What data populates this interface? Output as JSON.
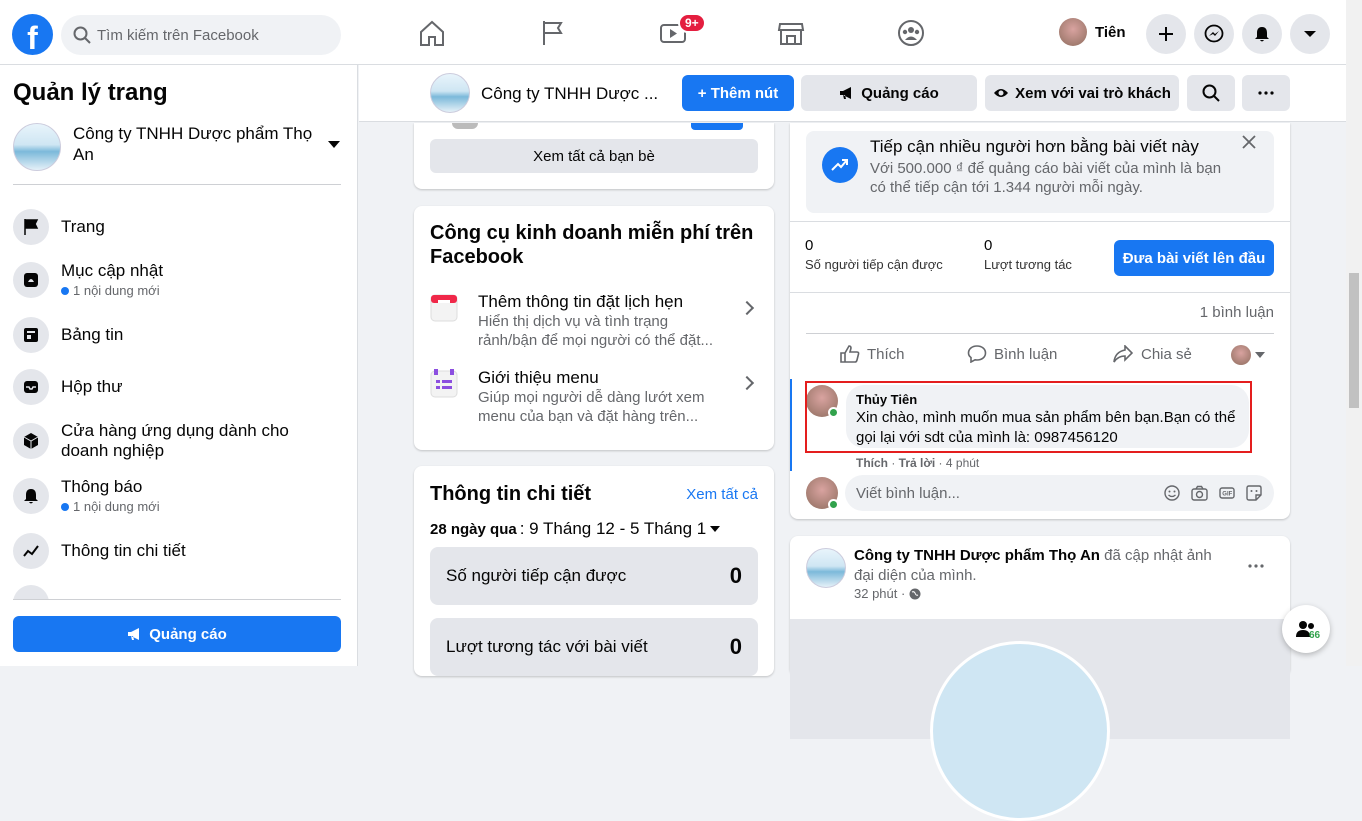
{
  "topbar": {
    "search_placeholder": "Tìm kiếm trên Facebook",
    "badge": "9+",
    "profile_name": "Tiên"
  },
  "sidebar": {
    "title": "Quản lý trang",
    "page_name": "Công ty TNHH Dược phẩm Thọ An",
    "items": [
      {
        "label": "Trang",
        "sub": ""
      },
      {
        "label": "Mục cập nhật",
        "sub": "1 nội dung mới"
      },
      {
        "label": "Bảng tin",
        "sub": ""
      },
      {
        "label": "Hộp thư",
        "sub": ""
      },
      {
        "label": "Cửa hàng ứng dụng dành cho doanh nghiệp",
        "sub": ""
      },
      {
        "label": "Thông báo",
        "sub": "1 nội dung mới"
      },
      {
        "label": "Thông tin chi tiết",
        "sub": ""
      }
    ],
    "ad_button": "Quảng cáo"
  },
  "page_header": {
    "page_name": "Công ty TNHH Dược ...",
    "add_button": "+ Thêm nút",
    "ads_button": "Quảng cáo",
    "view_as_button": "Xem với vai trò khách"
  },
  "friends": {
    "see_all": "Xem tất cả bạn bè"
  },
  "tools": {
    "title": "Công cụ kinh doanh miễn phí trên Facebook",
    "items": [
      {
        "title": "Thêm thông tin đặt lịch hẹn",
        "desc": "Hiển thị dịch vụ và tình trạng rảnh/bận để mọi người có thể đặt..."
      },
      {
        "title": "Giới thiệu menu",
        "desc": "Giúp mọi người dễ dàng lướt xem menu của bạn và đặt hàng trên..."
      }
    ]
  },
  "insights": {
    "title": "Thông tin chi tiết",
    "see_all": "Xem tất cả",
    "period_label": "28 ngày qua",
    "period_range": ": 9 Tháng 12 - 5 Tháng 1",
    "stats": [
      {
        "label": "Số người tiếp cận được",
        "value": "0"
      },
      {
        "label": "Lượt tương tác với bài viết",
        "value": "0"
      }
    ]
  },
  "post": {
    "boost_title": "Tiếp cận nhiều người hơn bằng bài viết này",
    "boost_desc": "Với 500.000 ₫ để quảng cáo bài viết của mình là bạn có thể tiếp cận tới 1.344 người mỗi ngày.",
    "reach_value": "0",
    "reach_label": "Số người tiếp cận được",
    "engage_value": "0",
    "engage_label": "Lượt tương tác",
    "boost_button": "Đưa bài viết lên đầu",
    "comment_count": "1 bình luận",
    "like": "Thích",
    "comment": "Bình luận",
    "share": "Chia sẻ",
    "commenter": "Thủy Tiên",
    "comment_text": "Xin chào, mình muốn mua sản phẩm bên bạn.Bạn có thể gọi lại với sdt của mình là: 0987456120",
    "comment_like": "Thích",
    "comment_reply": "Trả lời",
    "comment_time": "4 phút",
    "write_placeholder": "Viết bình luận..."
  },
  "post2": {
    "page_name": "Công ty TNHH Dược phẩm Thọ An",
    "action": "đã cập nhật ảnh đại diện của mình.",
    "time": "32 phút"
  },
  "contacts_count": "66",
  "colors": {
    "brand": "#1877f2",
    "highlight": "#e41e1e"
  }
}
